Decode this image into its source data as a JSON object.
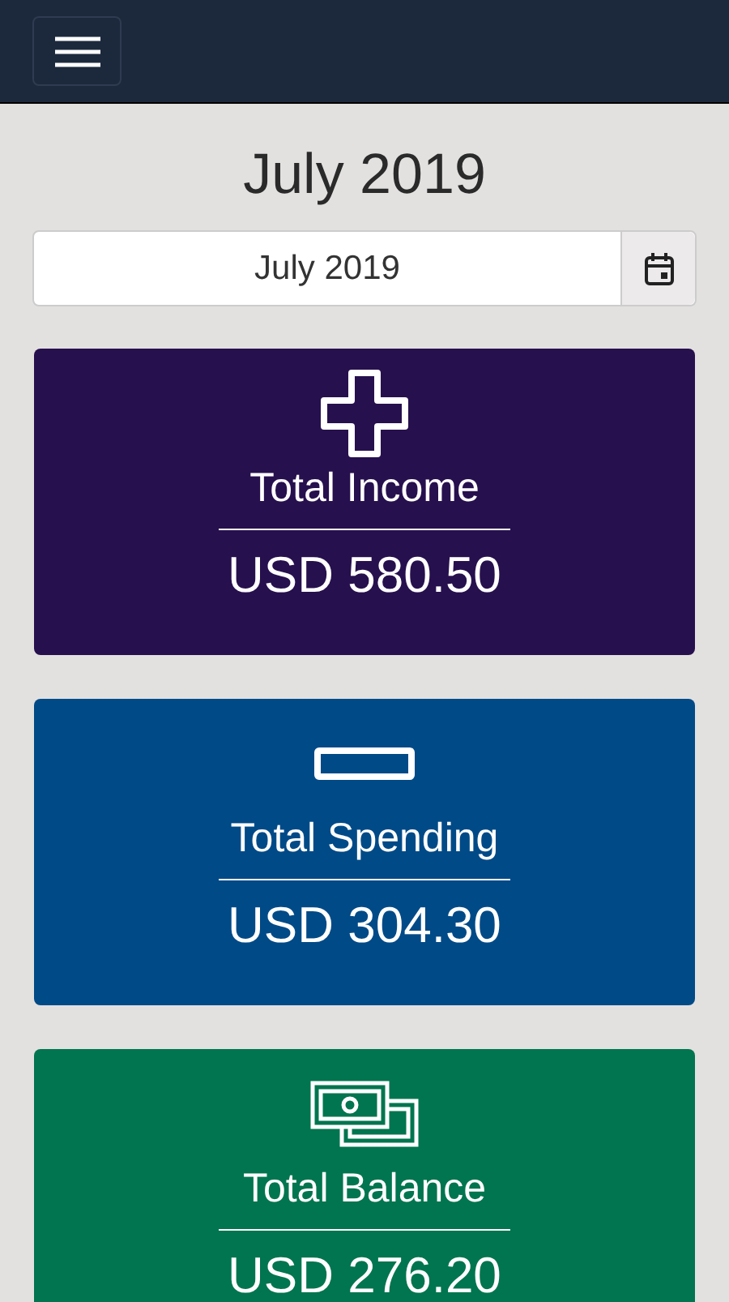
{
  "page_title": "July 2019",
  "month_field": {
    "value": "July 2019"
  },
  "cards": [
    {
      "kind": "income",
      "title": "Total Income",
      "amount": "USD 580.50",
      "color": "#27104e"
    },
    {
      "kind": "spending",
      "title": "Total Spending",
      "amount": "USD 304.30",
      "color": "#004a87"
    },
    {
      "kind": "balance",
      "title": "Total Balance",
      "amount": "USD 276.20",
      "color": "#00754f"
    }
  ]
}
